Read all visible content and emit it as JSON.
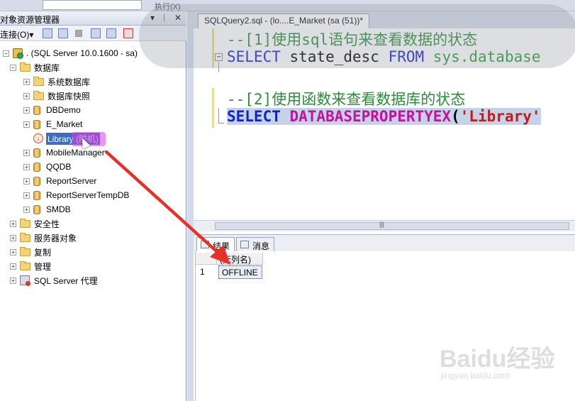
{
  "toolbar": {
    "execute_label": "执行(X)",
    "cmd_label": ""
  },
  "explorer": {
    "title": "对象资源管理器",
    "pin": "▾ ╨ ✕",
    "connect_label": "连接(O)▾",
    "server": ". (SQL Server 10.0.1600 - sa)",
    "databases_folder": "数据库",
    "items": [
      {
        "label": "系统数据库",
        "type": "folder"
      },
      {
        "label": "数据库快照",
        "type": "folder"
      },
      {
        "label": "DBDemo",
        "type": "db"
      },
      {
        "label": "E_Market",
        "type": "db"
      },
      {
        "label": "Library (脱机)",
        "type": "db-offline"
      },
      {
        "label": "MobileManager",
        "type": "db"
      },
      {
        "label": "QQDB",
        "type": "db"
      },
      {
        "label": "ReportServer",
        "type": "db"
      },
      {
        "label": "ReportServerTempDB",
        "type": "db"
      },
      {
        "label": "SMDB",
        "type": "db"
      }
    ],
    "top_folders": [
      {
        "label": "安全性"
      },
      {
        "label": "服务器对象"
      },
      {
        "label": "复制"
      },
      {
        "label": "管理"
      },
      {
        "label": "SQL Server 代理"
      }
    ]
  },
  "editor": {
    "tab_title": "SQLQuery2.sql - (lo....E_Market (sa (51))*",
    "lines": {
      "comment1": "--[1]使用sql语句来查看数据的状态",
      "select1_kw": "SELECT",
      "select1_col": " state_desc ",
      "select1_from": "FROM",
      "select1_sys": " sys.database",
      "comment2": "--[2]使用函数来查看数据库的状态",
      "select2_kw": "SELECT",
      "select2_fn": " DATABASEPROPERTYEX",
      "select2_open": "(",
      "select2_str": "'Library'"
    }
  },
  "results": {
    "tab_results": "结果",
    "tab_messages": "消息",
    "column_header": "(无列名)",
    "rows": [
      {
        "num": "1",
        "value": "OFFLINE"
      }
    ]
  },
  "watermark": {
    "brand": "Baidu经验",
    "sub": "jingyan.baidu.com"
  },
  "colors": {
    "arrow": "#e8302a",
    "selection": "#3a6ec3",
    "comment": "#2e8b3c",
    "keyword": "#1222c8"
  }
}
